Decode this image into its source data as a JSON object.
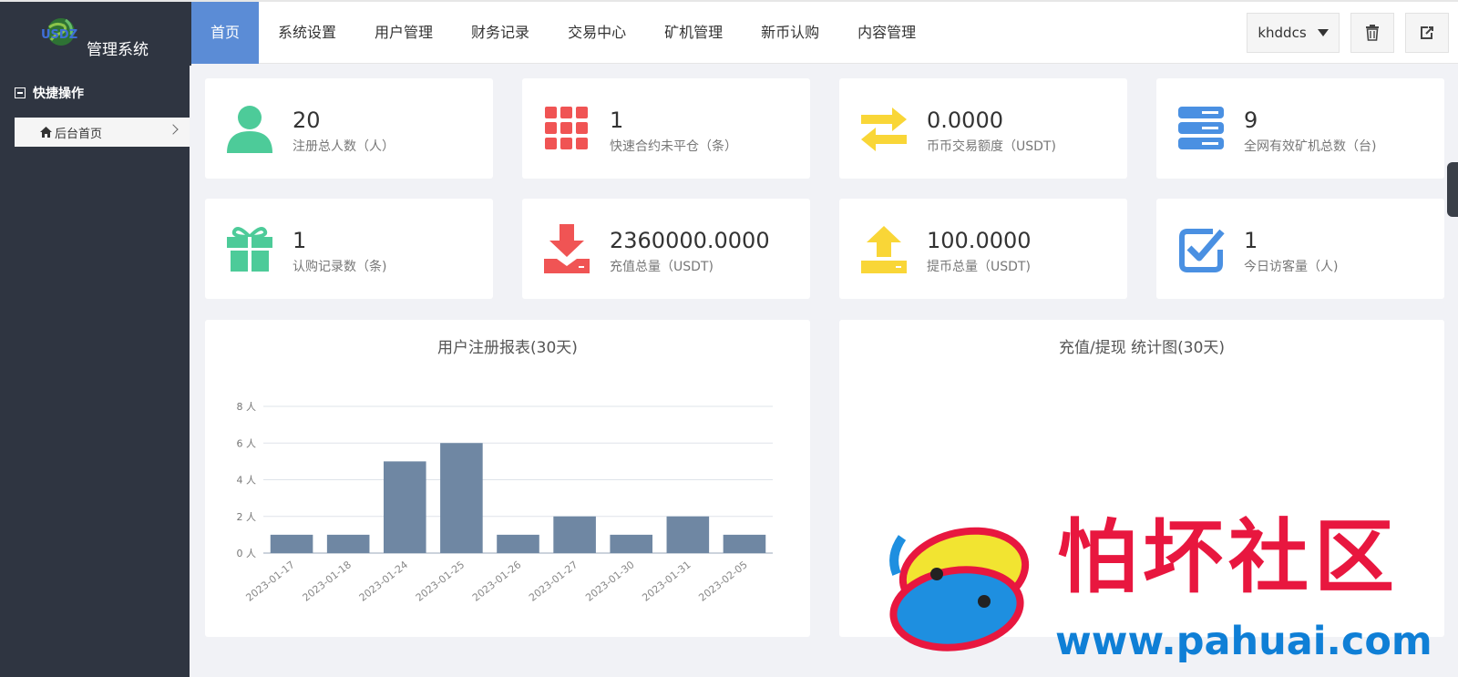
{
  "logo": {
    "mark_text": "USDZ",
    "title": "管理系统"
  },
  "nav": [
    {
      "label": "首页",
      "active": true
    },
    {
      "label": "系统设置"
    },
    {
      "label": "用户管理"
    },
    {
      "label": "财务记录"
    },
    {
      "label": "交易中心"
    },
    {
      "label": "矿机管理"
    },
    {
      "label": "新币认购"
    },
    {
      "label": "内容管理"
    }
  ],
  "user": {
    "name": "khddcs",
    "icon": "chevron-down-icon"
  },
  "toolbar": {
    "clear_icon": "trash-icon",
    "logout_icon": "logout-icon"
  },
  "sidebar": {
    "section_title": "快捷操作",
    "items": [
      {
        "label": "后台首页",
        "icon": "home-icon"
      }
    ]
  },
  "stats": [
    {
      "value": "20",
      "label": "注册总人数（人）",
      "icon": "user-icon",
      "color": "#4dcb99"
    },
    {
      "value": "1",
      "label": "快速合约未平仓（条）",
      "icon": "grid-icon",
      "color": "#f05454"
    },
    {
      "value": "0.0000",
      "label": "币币交易额度（USDT)",
      "icon": "exchange-icon",
      "color": "#f9d637"
    },
    {
      "value": "9",
      "label": "全网有效矿机总数（台)",
      "icon": "server-icon",
      "color": "#4a90e2"
    },
    {
      "value": "1",
      "label": "认购记录数（条)",
      "icon": "gift-icon",
      "color": "#4dcb99"
    },
    {
      "value": "2360000.0000",
      "label": "充值总量（USDT)",
      "icon": "download-icon",
      "color": "#f05454"
    },
    {
      "value": "100.0000",
      "label": "提币总量（USDT)",
      "icon": "upload-icon",
      "color": "#f9d637"
    },
    {
      "value": "1",
      "label": "今日访客量（人)",
      "icon": "checkbox-icon",
      "color": "#4a90e2"
    }
  ],
  "panels": {
    "register_title": "用户注册报表(30天)",
    "finance_title": "充值/提现 统计图(30天)"
  },
  "chart_data": {
    "type": "bar",
    "title": "用户注册报表(30天)",
    "categories": [
      "2023-01-17",
      "2023-01-18",
      "2023-01-24",
      "2023-01-25",
      "2023-01-26",
      "2023-01-27",
      "2023-01-30",
      "2023-01-31",
      "2023-02-05"
    ],
    "values": [
      1,
      1,
      5,
      6,
      1,
      2,
      1,
      2,
      1
    ],
    "yticks": [
      "0 人",
      "2 人",
      "4 人",
      "6 人",
      "8 人"
    ],
    "ylim": [
      0,
      8
    ],
    "grid": true,
    "bar_color": "#6f87a3"
  },
  "watermark": {
    "text": "怕坏社区",
    "url": "www.pahuai.com"
  }
}
